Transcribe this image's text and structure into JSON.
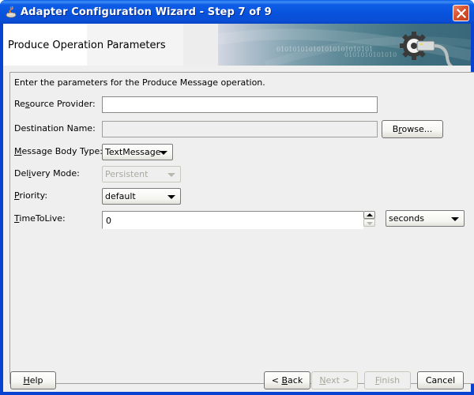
{
  "window": {
    "title": "Adapter Configuration Wizard - Step 7 of 9",
    "close_icon": "close-x-icon"
  },
  "header": {
    "title": "Produce Operation Parameters",
    "graphic_text_1": "010101010101010101010101",
    "graphic_text_2": "0101010101010"
  },
  "form": {
    "intro": "Enter the parameters for the Produce Message operation.",
    "resource_provider": {
      "label_pre": "Re",
      "label_mn": "s",
      "label_post": "ource Provider:",
      "value": ""
    },
    "destination_name": {
      "label": "Destination Name:",
      "value": ""
    },
    "browse": {
      "label_pre": "B",
      "label_mn": "r",
      "label_post": "owse..."
    },
    "message_body_type": {
      "label_pre": "",
      "label_mn": "M",
      "label_post": "essage Body Type:",
      "value": "TextMessage"
    },
    "delivery_mode": {
      "label_pre": "Del",
      "label_mn": "i",
      "label_post": "very Mode:",
      "value": "Persistent"
    },
    "priority": {
      "label_pre": "",
      "label_mn": "P",
      "label_post": "riority:",
      "value": "default"
    },
    "time_to_live": {
      "label_pre": "",
      "label_mn": "T",
      "label_post": "imeToLive:",
      "value": "0",
      "unit": "seconds"
    }
  },
  "footer": {
    "help": {
      "mn": "H",
      "rest": "elp"
    },
    "back": {
      "pre": "< ",
      "mn": "B",
      "rest": "ack"
    },
    "next": {
      "mn": "N",
      "rest": "ext >"
    },
    "finish": {
      "mn": "F",
      "rest": "inish"
    },
    "cancel": "Cancel"
  }
}
